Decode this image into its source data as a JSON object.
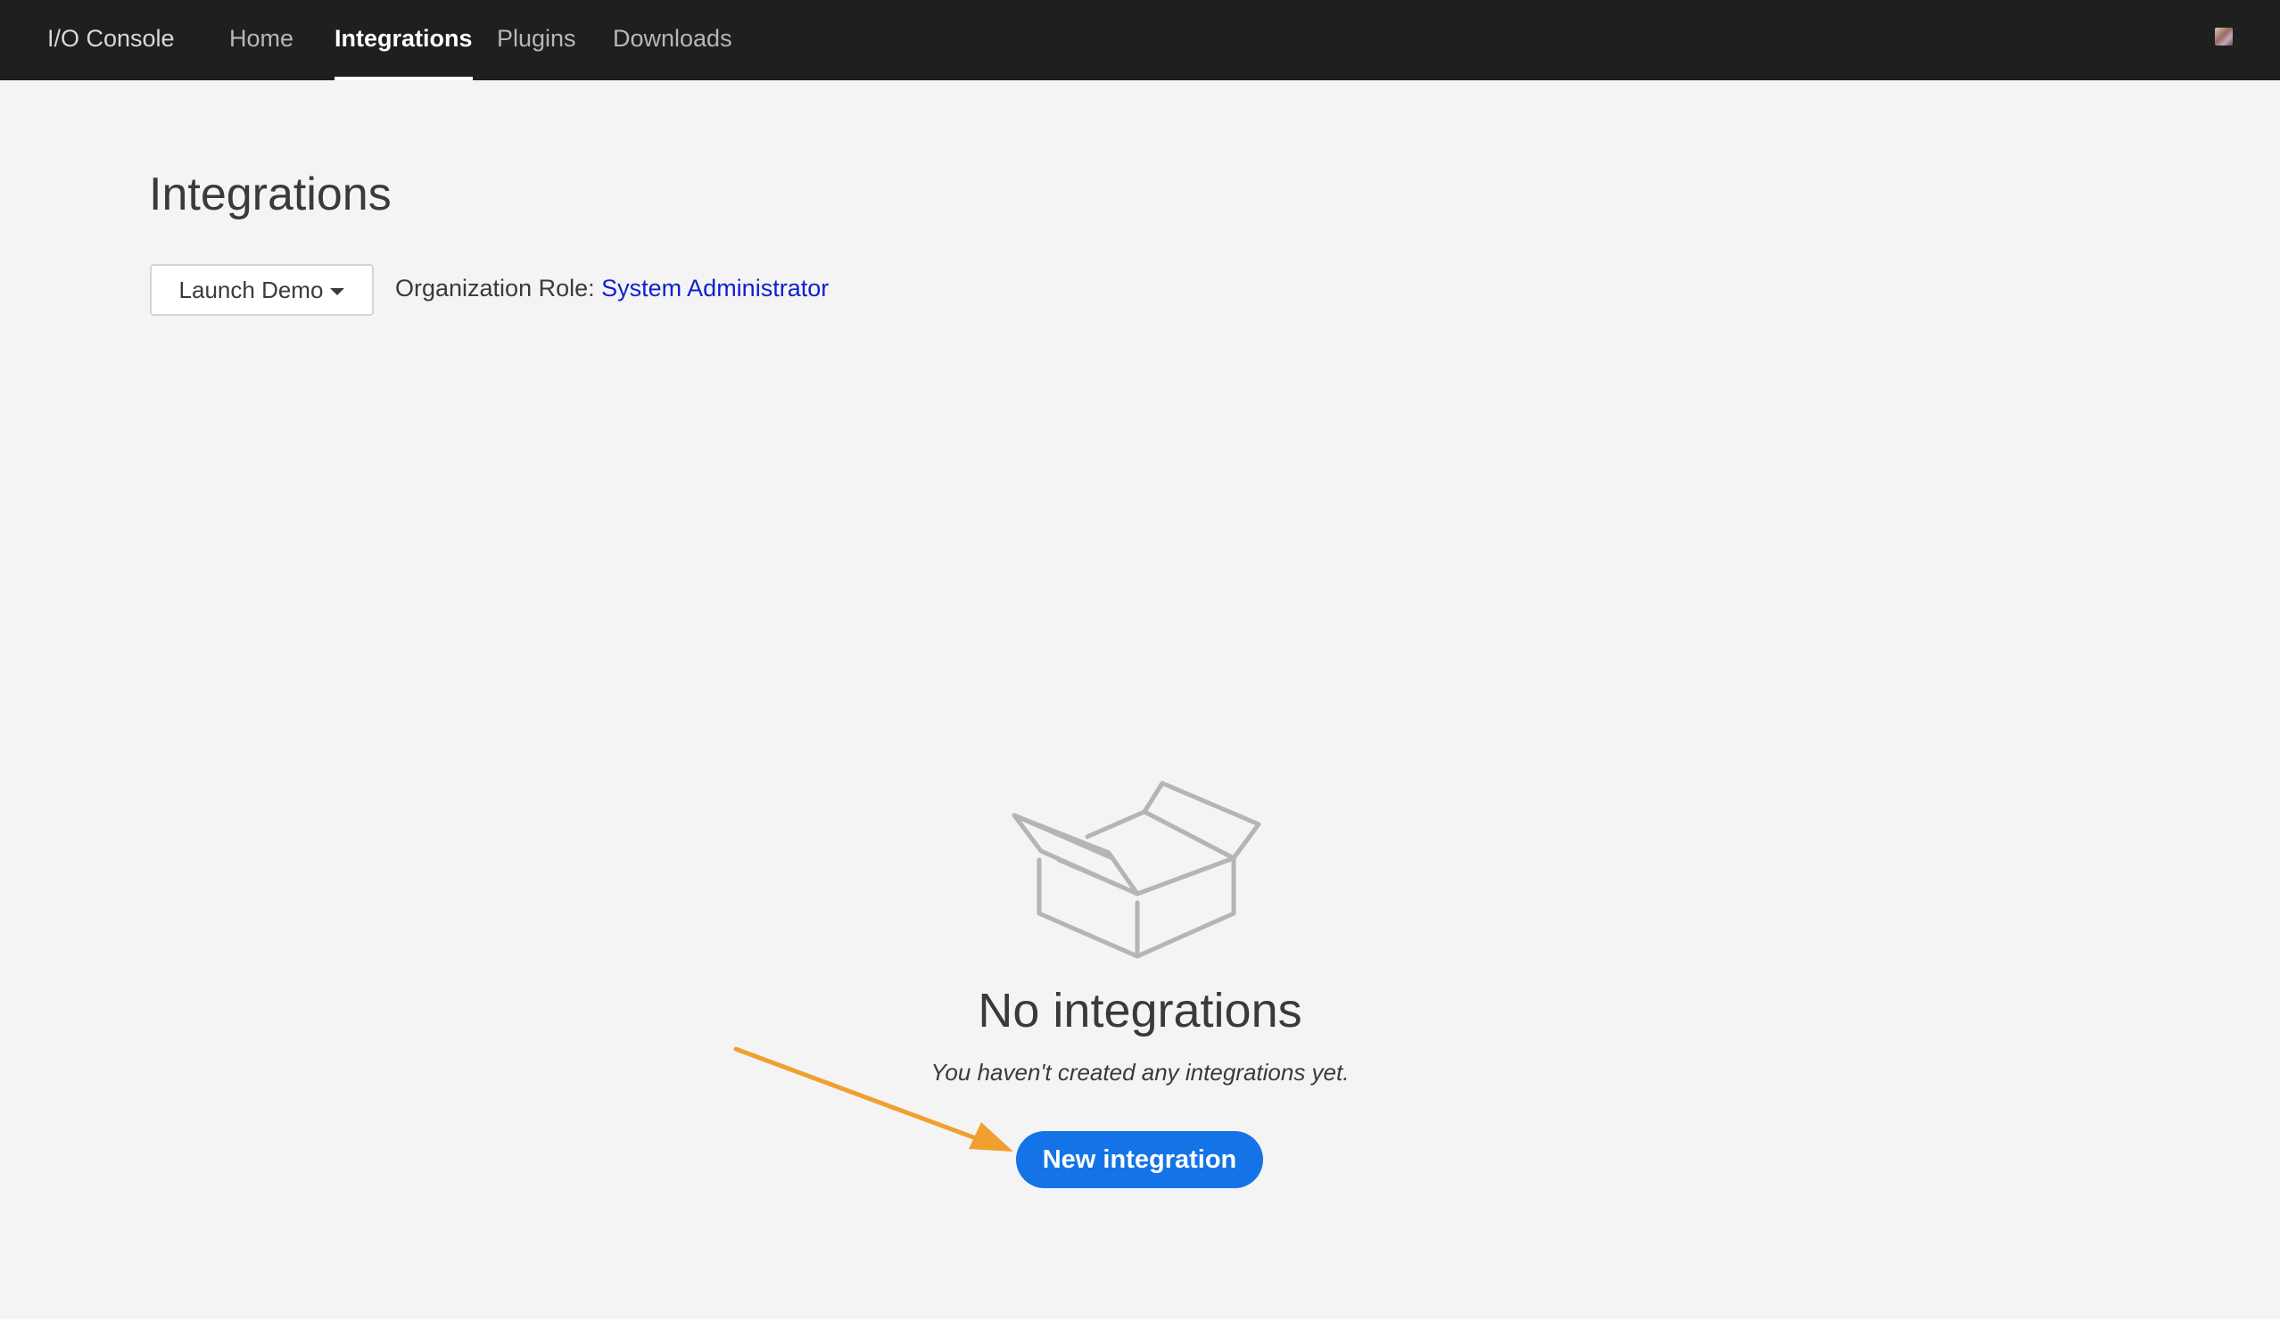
{
  "topbar": {
    "brand": "I/O Console",
    "nav": [
      {
        "label": "Home",
        "active": false
      },
      {
        "label": "Integrations",
        "active": true
      },
      {
        "label": "Plugins",
        "active": false
      },
      {
        "label": "Downloads",
        "active": false
      }
    ],
    "avatar_icon": "user-avatar"
  },
  "page": {
    "title": "Integrations",
    "org_select_label": "Launch Demo",
    "org_role_label": "Organization Role:",
    "org_role_value": "System Administrator"
  },
  "empty_state": {
    "icon": "open-box-icon",
    "title": "No integrations",
    "subtitle": "You haven't created any integrations yet.",
    "button_label": "New integration"
  },
  "colors": {
    "topbar_bg": "#1f1f1f",
    "page_bg": "#f4f4f4",
    "primary_button": "#1473e6",
    "link": "#1020d0",
    "annotation_arrow": "#f0a030"
  }
}
